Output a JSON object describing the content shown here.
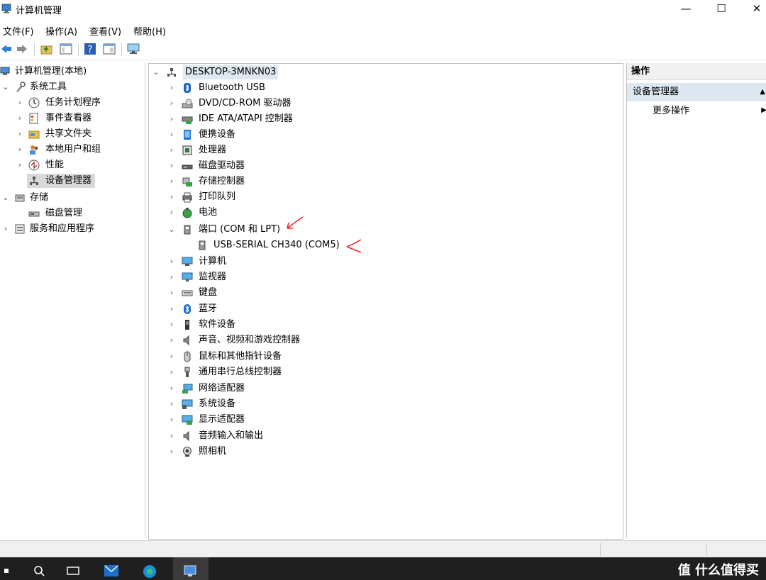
{
  "window": {
    "title": "计算机管理",
    "minimize": "—",
    "maximize": "☐",
    "close": "✕"
  },
  "menu": [
    "文件(F)",
    "操作(A)",
    "查看(V)",
    "帮助(H)"
  ],
  "toolbar": {
    "back": "back-arrow-icon",
    "forward": "forward-arrow-icon",
    "up": "up-folder-icon",
    "show_hide": "console-tree-icon",
    "help": "help-icon",
    "view": "properties-icon",
    "monitor": "monitor-icon"
  },
  "tree": {
    "root": "计算机管理(本地)",
    "system_tools": "系统工具",
    "items": [
      "任务计划程序",
      "事件查看器",
      "共享文件夹",
      "本地用户和组",
      "性能",
      "设备管理器"
    ],
    "storage": "存储",
    "storage_items": [
      "磁盘管理"
    ],
    "services": "服务和应用程序"
  },
  "devices": {
    "computer": "DESKTOP-3MNKN03",
    "categories": [
      "Bluetooth USB",
      "DVD/CD-ROM 驱动器",
      "IDE ATA/ATAPI 控制器",
      "便携设备",
      "处理器",
      "磁盘驱动器",
      "存储控制器",
      "打印队列",
      "电池",
      "端口 (COM 和 LPT)",
      "计算机",
      "监视器",
      "键盘",
      "蓝牙",
      "软件设备",
      "声音、视频和游戏控制器",
      "鼠标和其他指针设备",
      "通用串行总线控制器",
      "网络适配器",
      "系统设备",
      "显示适配器",
      "音频输入和输出",
      "照相机"
    ],
    "port_child": "USB-SERIAL CH340 (COM5)"
  },
  "actions": {
    "header": "操作",
    "section": "设备管理器",
    "more": "更多操作"
  },
  "watermark": "值 什么值得买",
  "colors": {
    "selection": "#d9d9d9",
    "action_section": "#dde8f3",
    "annotation": "#ff2020",
    "taskbar": "#1f1f1f"
  }
}
